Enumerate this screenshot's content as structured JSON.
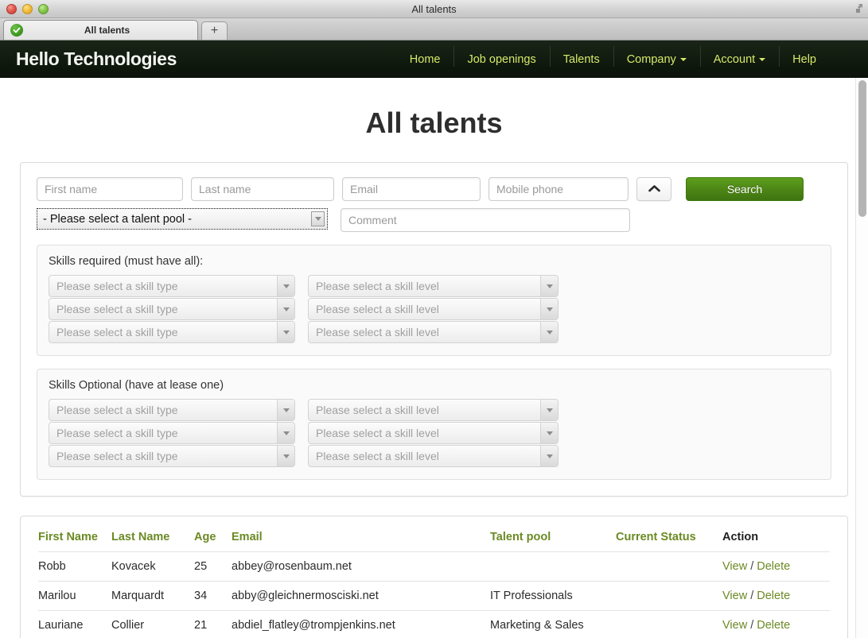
{
  "window": {
    "title": "All talents",
    "traffic_lights": [
      "close-red",
      "minimize-yellow",
      "zoom-green"
    ],
    "fullscreen_icon": "fullscreen-icon"
  },
  "tabs": {
    "items": [
      {
        "title": "All talents",
        "favicon": "green-check-favicon"
      }
    ],
    "new_tab_label": "+"
  },
  "site_header": {
    "logo": "Hello Technologies",
    "nav": [
      {
        "label": "Home",
        "has_caret": false
      },
      {
        "label": "Job openings",
        "has_caret": false
      },
      {
        "label": "Talents",
        "has_caret": false
      },
      {
        "label": "Company",
        "has_caret": true
      },
      {
        "label": "Account",
        "has_caret": true
      },
      {
        "label": "Help",
        "has_caret": false
      }
    ],
    "bg_color": "#101a0e",
    "link_color": "#d6ea6a",
    "logo_color": "#f4f7f2"
  },
  "page": {
    "title": "All talents"
  },
  "search_form": {
    "first_name_placeholder": "First name",
    "first_name_value": "",
    "last_name_placeholder": "Last name",
    "last_name_value": "",
    "email_placeholder": "Email",
    "email_value": "",
    "mobile_placeholder": "Mobile phone",
    "mobile_value": "",
    "comment_placeholder": "Comment",
    "comment_value": "",
    "talent_pool_value": "- Please select a talent pool -",
    "collapse_icon": "chevron-up-icon",
    "search_label": "Search",
    "search_button_color": "#4c8516",
    "required_skills": {
      "legend": "Skills required (must have all):",
      "rows": [
        {
          "type": "Please select a skill type",
          "level": "Please select a skill level"
        },
        {
          "type": "Please select a skill type",
          "level": "Please select a skill level"
        },
        {
          "type": "Please select a skill type",
          "level": "Please select a skill level"
        }
      ]
    },
    "optional_skills": {
      "legend": "Skills Optional (have at lease one)",
      "rows": [
        {
          "type": "Please select a skill type",
          "level": "Please select a skill level"
        },
        {
          "type": "Please select a skill type",
          "level": "Please select a skill level"
        },
        {
          "type": "Please select a skill type",
          "level": "Please select a skill level"
        }
      ]
    }
  },
  "results": {
    "columns": [
      {
        "label": "First Name",
        "dark": false
      },
      {
        "label": "Last Name",
        "dark": false
      },
      {
        "label": "Age",
        "dark": false
      },
      {
        "label": "Email",
        "dark": false
      },
      {
        "label": "Talent pool",
        "dark": false
      },
      {
        "label": "Current Status",
        "dark": false
      },
      {
        "label": "Action",
        "dark": true
      }
    ],
    "header_color": "#6b8a24",
    "rows": [
      {
        "first_name": "Robb",
        "last_name": "Kovacek",
        "age": "25",
        "email": "abbey@rosenbaum.net",
        "talent_pool": "",
        "current_status": "",
        "view_label": "View",
        "separator": "/",
        "delete_label": "Delete"
      },
      {
        "first_name": "Marilou",
        "last_name": "Marquardt",
        "age": "34",
        "email": "abby@gleichnermosciski.net",
        "talent_pool": "IT Professionals",
        "current_status": "",
        "view_label": "View",
        "separator": "/",
        "delete_label": "Delete"
      },
      {
        "first_name": "Lauriane",
        "last_name": "Collier",
        "age": "21",
        "email": "abdiel_flatley@trompjenkins.net",
        "talent_pool": "Marketing & Sales",
        "current_status": "",
        "view_label": "View",
        "separator": "/",
        "delete_label": "Delete"
      }
    ]
  }
}
